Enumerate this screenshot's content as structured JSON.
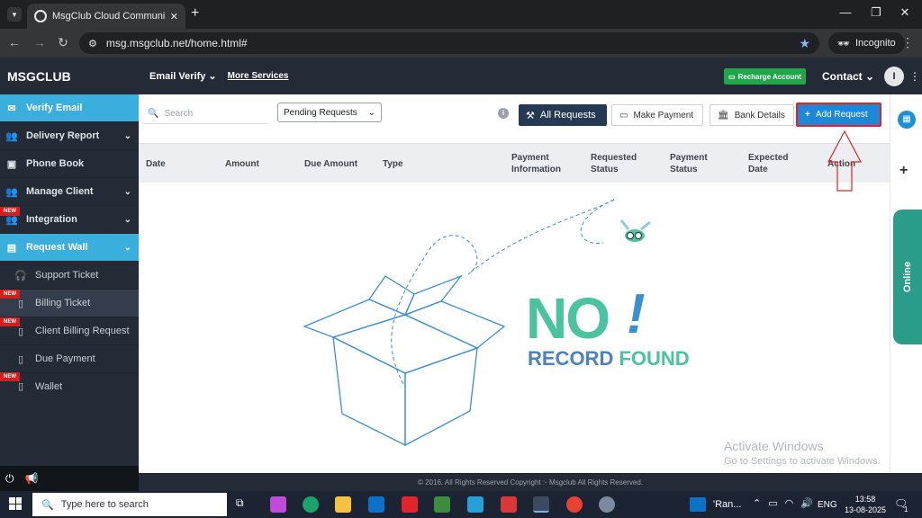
{
  "browser": {
    "tab_title": "MsgClub Cloud Communication",
    "url": "msg.msgclub.net/home.html#",
    "incognito_label": "Incognito"
  },
  "brand": "MSGCLUB",
  "topnav": {
    "email_verify": "Email Verify",
    "more_services": "More Services",
    "recharge": "Recharge Account",
    "contact": "Contact",
    "avatar_initial": "I"
  },
  "sidebar": {
    "items": [
      {
        "label": "Verify Email"
      },
      {
        "label": "Delivery Report"
      },
      {
        "label": "Phone Book"
      },
      {
        "label": "Manage Client"
      },
      {
        "label": "Integration"
      },
      {
        "label": "Request Wall"
      },
      {
        "label": "Support Ticket"
      },
      {
        "label": "Billing Ticket"
      },
      {
        "label": "Client Billing Request"
      },
      {
        "label": "Due Payment"
      },
      {
        "label": "Wallet"
      }
    ],
    "new_badge": "NEW"
  },
  "toolbar": {
    "search_placeholder": "Search",
    "filter_value": "Pending Requests",
    "all_requests": "All Requests",
    "make_payment": "Make Payment",
    "bank_details": "Bank Details",
    "add_request": "Add Request"
  },
  "table": {
    "headers": [
      "Date",
      "Amount",
      "Due Amount",
      "Type",
      "Payment Information",
      "Requested Status",
      "Payment Status",
      "Expected Date",
      "Action"
    ]
  },
  "empty_state": {
    "big": "NO",
    "exclaim": "!",
    "record": "RECORD",
    "found": "FOUND"
  },
  "online_tab": "Online",
  "footer": "© 2016. All Rights Reserved Copyright :- Msgclub All Rights Reserved.",
  "watermark": {
    "line1": "Activate Windows",
    "line2": "Go to Settings to activate Windows."
  },
  "taskbar": {
    "search_placeholder": "Type here to search",
    "app_label": "'Ran...",
    "lang": "ENG",
    "time": "13:58",
    "date": "13-08-2025",
    "notif_count": "1"
  },
  "colors": {
    "accent": "#3aaedc",
    "sidebar": "#252b36",
    "teal": "#4cc3a0",
    "blue_text": "#4a82c3",
    "highlight": "#e02424"
  }
}
